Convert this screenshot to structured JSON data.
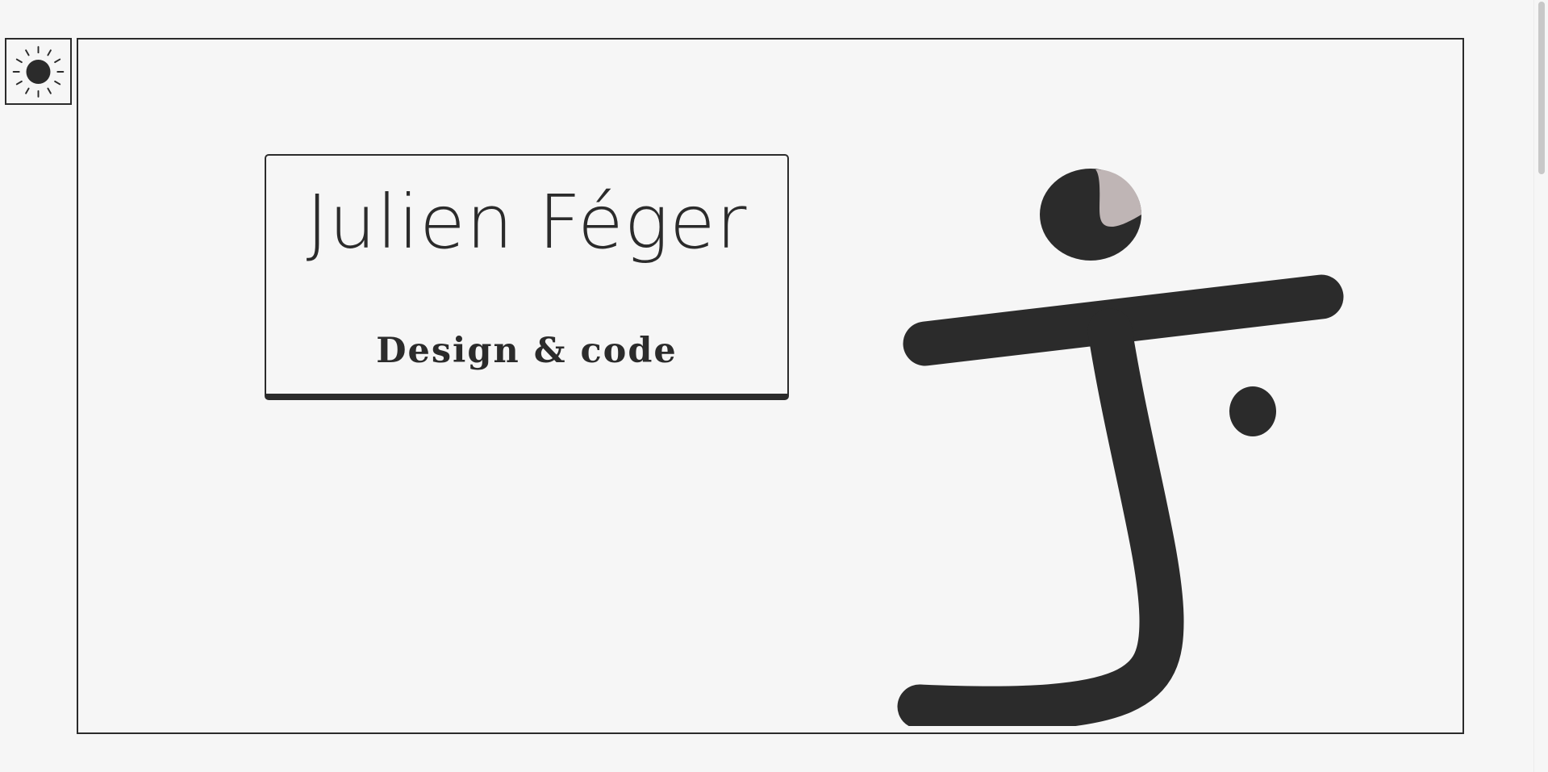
{
  "header": {
    "theme_toggle_icon": "sun-icon"
  },
  "hero": {
    "name": "Julien Féger",
    "tagline": "Design & code",
    "logo_icon": "j-monogram-logo"
  },
  "colors": {
    "background": "#f6f6f6",
    "ink": "#2b2b2b",
    "accent": "#bfb5b5"
  }
}
